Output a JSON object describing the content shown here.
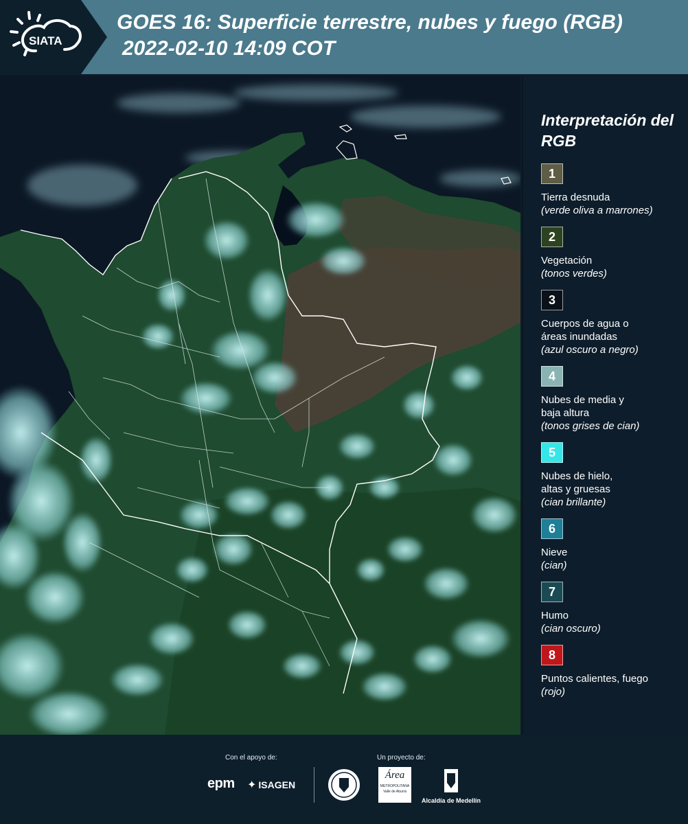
{
  "header": {
    "logo_text": "SIATA",
    "title": "GOES 16: Superficie terrestre, nubes y fuego (RGB)",
    "subtitle": "2022-02-10 14:09 COT"
  },
  "legend": {
    "title": "Interpretación del RGB",
    "items": [
      {
        "num": "1",
        "label": "Tierra desnuda",
        "sub": "(verde oliva a marrones)",
        "color": "#5e5d45",
        "num_color": "#ffffff"
      },
      {
        "num": "2",
        "label": "Vegetación",
        "sub": "(tonos verdes)",
        "color": "#2d4320",
        "num_color": "#ffffff"
      },
      {
        "num": "3",
        "label": "Cuerpos de agua o\náreas inundadas",
        "sub": "(azul oscuro a negro)",
        "color": "#0b1119",
        "num_color": "#ffffff"
      },
      {
        "num": "4",
        "label": "Nubes de media y\nbaja altura",
        "sub": "(tonos grises de cian)",
        "color": "#8ab4b4",
        "num_color": "#ffffff"
      },
      {
        "num": "5",
        "label": "Nubes de hielo,\naltas y gruesas",
        "sub": "(cian brillante)",
        "color": "#35e6e8",
        "num_color": "#ffffff"
      },
      {
        "num": "6",
        "label": "Nieve",
        "sub": "(cian)",
        "color": "#1e7f96",
        "num_color": "#ffffff"
      },
      {
        "num": "7",
        "label": "Humo",
        "sub": "(cian oscuro)",
        "color": "#1a4b54",
        "num_color": "#ffffff"
      },
      {
        "num": "8",
        "label": "Puntos calientes, fuego",
        "sub": "(rojo)",
        "color": "#c0171c",
        "num_color": "#ffffff"
      }
    ]
  },
  "footer": {
    "support_caption": "Con el apoyo de:",
    "project_caption": "Un proyecto de:",
    "sponsor_1": "epm",
    "sponsor_2": "ISAGEN",
    "partner_1": "Área",
    "partner_1_line2": "METROPOLITANA",
    "partner_1_line3": "Valle de Aburrá",
    "partner_2": "Alcaldía de Medellín"
  },
  "colors": {
    "background": "#0d1d2b",
    "header_band": "#4a7a8c",
    "ocean": "#0a1522",
    "vegetation": "#1f4a2f",
    "bare_soil": "#4e3e36",
    "cloud": "#9fe6e6",
    "borders": "#ffffff"
  }
}
